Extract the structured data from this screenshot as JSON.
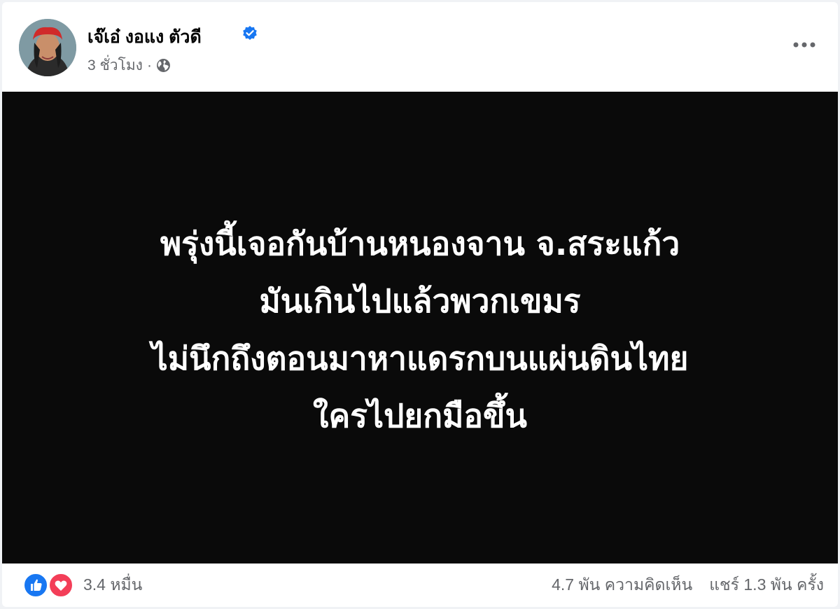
{
  "post": {
    "author": {
      "name": "เจ๊เอ๋ งอแง ตัวดี",
      "verified": true
    },
    "timestamp": "3 ชั่วโมง",
    "separator": "·",
    "privacy_icon": "globe-icon",
    "more_icon": "more-options-icon",
    "image_text_lines": [
      "พรุ่งนี้เจอกันบ้านหนองจาน จ.สระแก้ว",
      "มันเกินไปแล้วพวกเขมร",
      "ไม่นึกถึงตอนมาหาแดรกบนแผ่นดินไทย",
      "ใครไปยกมือขึ้น"
    ],
    "reactions": {
      "icons": [
        "like-icon",
        "love-icon"
      ],
      "count": "3.4 หมื่น"
    },
    "comments": "4.7 พัน ความคิดเห็น",
    "shares": "แชร์ 1.3 พัน ครั้ง"
  },
  "colors": {
    "accent": "#1877f2",
    "love": "#f33e58",
    "image_background": "#0a0a0a",
    "secondary_text": "#65676b"
  }
}
